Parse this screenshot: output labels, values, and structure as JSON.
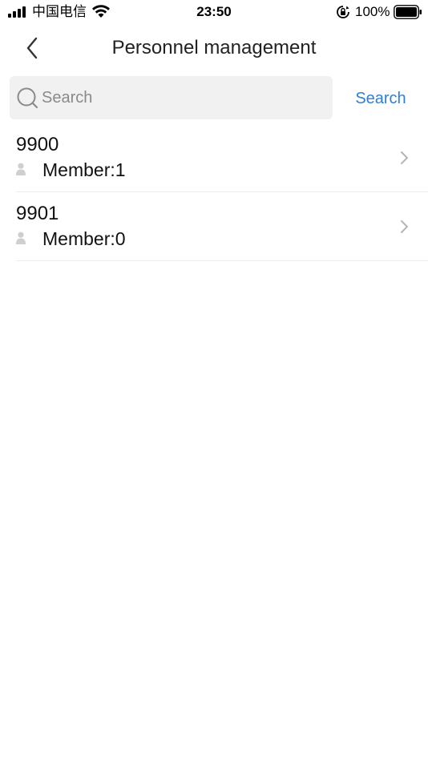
{
  "status_bar": {
    "carrier": "中国电信",
    "time": "23:50",
    "battery_percent": "100%",
    "icons": [
      "signal-icon",
      "wifi-icon",
      "rotation-lock-icon",
      "battery-icon"
    ]
  },
  "nav": {
    "title": "Personnel management",
    "back_icon": "chevron-left-icon"
  },
  "search": {
    "placeholder": "Search",
    "value": "",
    "button_label": "Search",
    "icon": "search-icon"
  },
  "list": {
    "items": [
      {
        "name": "9900",
        "member_label": "Member:1"
      },
      {
        "name": "9901",
        "member_label": "Member:0"
      }
    ],
    "item_icon": "person-icon",
    "chevron_icon": "chevron-right-icon"
  },
  "colors": {
    "accent": "#2f7ed8",
    "search_bg": "#f1f1f1",
    "divider": "#ececec",
    "icon_gray": "#c8c8c8"
  }
}
